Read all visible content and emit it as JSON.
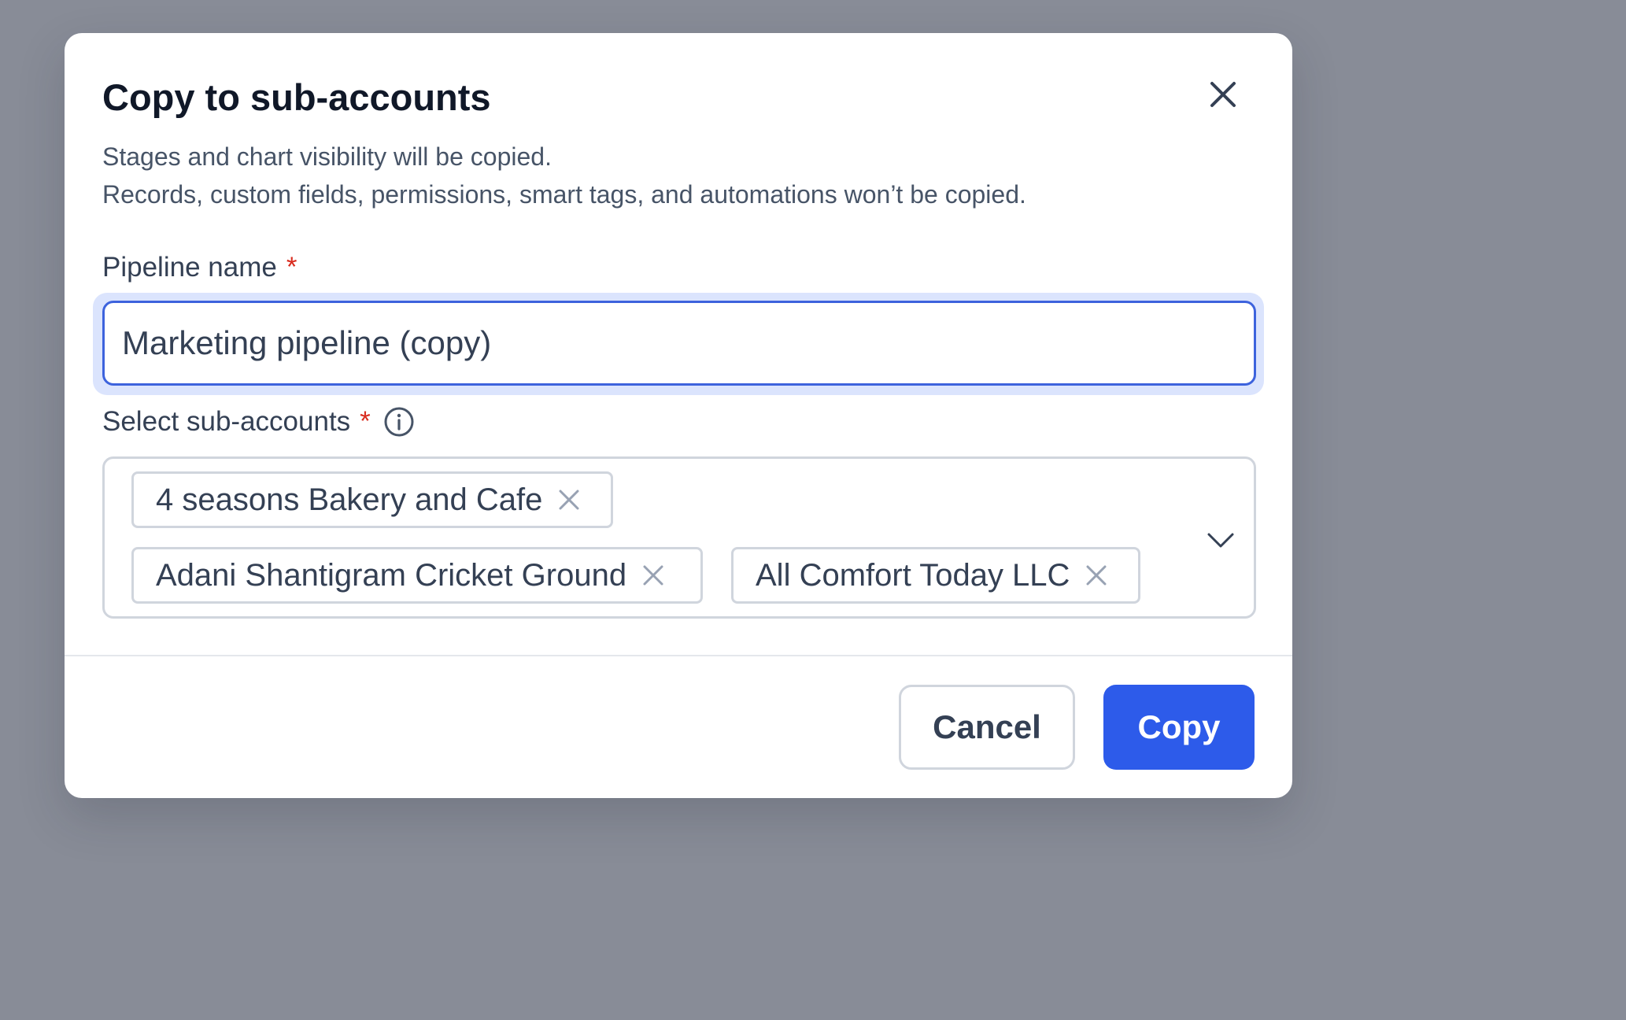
{
  "modal": {
    "title": "Copy to sub-accounts",
    "description_line1": "Stages and chart visibility will be copied.",
    "description_line2": "Records, custom fields, permissions, smart tags, and automations won’t be copied.",
    "close_icon": "close-icon"
  },
  "pipeline_name": {
    "label": "Pipeline name",
    "required_mark": "*",
    "value": "Marketing pipeline (copy)"
  },
  "sub_accounts": {
    "label": "Select sub-accounts",
    "required_mark": "*",
    "info_icon": "info-icon",
    "selected": [
      "4 seasons Bakery and Cafe",
      "Adani Shantigram Cricket Ground",
      "All Comfort Today LLC"
    ],
    "dropdown_icon": "chevron-down-icon"
  },
  "footer": {
    "cancel_label": "Cancel",
    "copy_label": "Copy"
  },
  "colors": {
    "backdrop": "#888c97",
    "primary": "#2d5bea",
    "focus_ring": "#3d63dd",
    "required": "#d92d20"
  }
}
